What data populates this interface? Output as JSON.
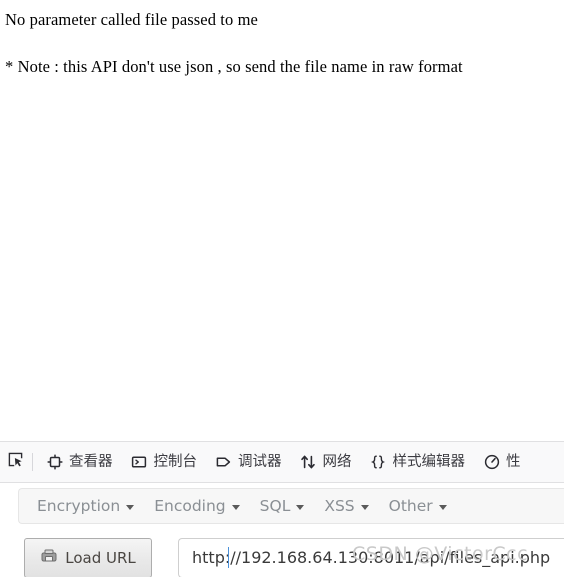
{
  "page_content": {
    "line1": "No parameter called file passed to me",
    "line2": "* Note : this API don't use json , so send the file name in raw format"
  },
  "devtools": {
    "picker_icon": "element-picker-icon",
    "tabs": [
      {
        "label": "查看器",
        "icon": "inspector-icon"
      },
      {
        "label": "控制台",
        "icon": "console-icon"
      },
      {
        "label": "调试器",
        "icon": "debugger-icon"
      },
      {
        "label": "网络",
        "icon": "network-icon"
      },
      {
        "label": "样式编辑器",
        "icon": "style-editor-icon"
      },
      {
        "label": "性",
        "icon": "performance-icon"
      }
    ]
  },
  "hackbar": {
    "menus": [
      {
        "label": "Encryption"
      },
      {
        "label": "Encoding"
      },
      {
        "label": "SQL"
      },
      {
        "label": "XSS"
      },
      {
        "label": "Other"
      }
    ],
    "load_url_label": "Load URL",
    "load_url_icon": "load-url-icon",
    "url_value": "http://192.168.64.130:8011/api/files_api.php"
  },
  "watermark": {
    "text": "CSDN @VictorCcc"
  },
  "colors": {
    "devtools_bg": "#f9f9fa",
    "devtools_border": "#e0e0e2",
    "hackbar_menu_bg": "#f7f7f7",
    "menu_text": "#8a8f94",
    "caret_accent": "#4a90d9",
    "watermark": "#c9c9c9"
  }
}
